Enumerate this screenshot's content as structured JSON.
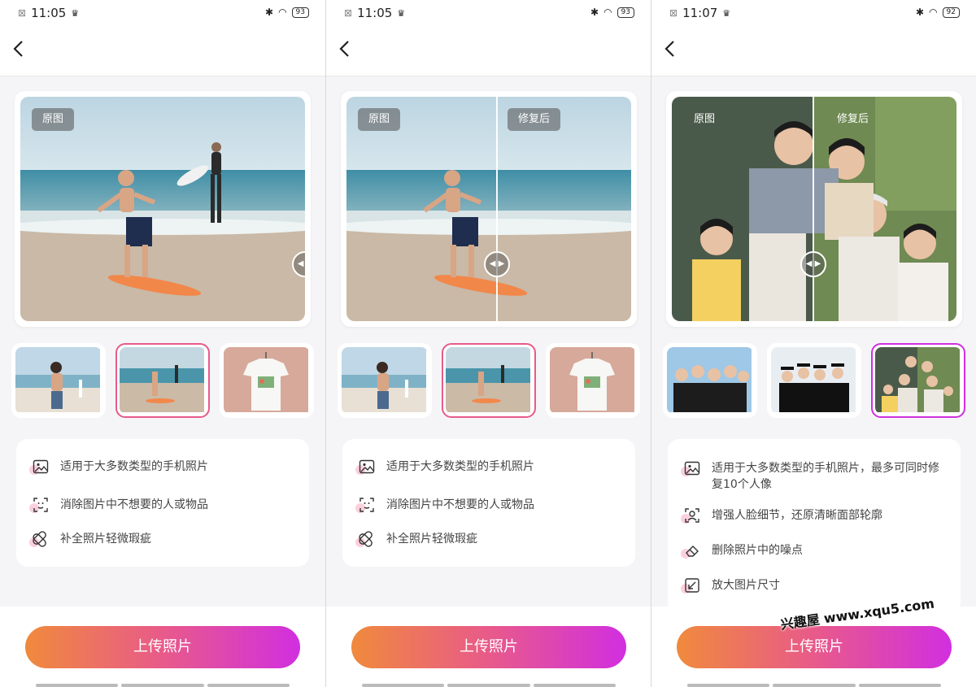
{
  "screens": [
    {
      "status": {
        "time": "11:05",
        "battery": "93"
      },
      "viewer": {
        "label_before": "原图",
        "label_after": ""
      },
      "thumbnails": [
        "beach-woman",
        "surfer-boy",
        "tshirt"
      ],
      "selected_thumbnail": 1,
      "features": [
        {
          "icon": "image-icon",
          "text": "适用于大多数类型的手机照片"
        },
        {
          "icon": "face-scan-icon",
          "text": "消除图片中不想要的人或物品"
        },
        {
          "icon": "bandage-icon",
          "text": "补全照片轻微瑕疵"
        }
      ],
      "upload_label": "上传照片"
    },
    {
      "status": {
        "time": "11:05",
        "battery": "93"
      },
      "viewer": {
        "label_before": "原图",
        "label_after": "修复后"
      },
      "thumbnails": [
        "beach-woman",
        "surfer-boy",
        "tshirt"
      ],
      "selected_thumbnail": 1,
      "features": [
        {
          "icon": "image-icon",
          "text": "适用于大多数类型的手机照片"
        },
        {
          "icon": "face-scan-icon",
          "text": "消除图片中不想要的人或物品"
        },
        {
          "icon": "bandage-icon",
          "text": "补全照片轻微瑕疵"
        }
      ],
      "upload_label": "上传照片"
    },
    {
      "status": {
        "time": "11:07",
        "battery": "92"
      },
      "viewer": {
        "label_before": "原图",
        "label_after": "修复后"
      },
      "thumbnails": [
        "group-friends",
        "graduates",
        "family"
      ],
      "selected_thumbnail": 2,
      "features": [
        {
          "icon": "image-icon",
          "text": "适用于大多数类型的手机照片，最多可同时修复10个人像"
        },
        {
          "icon": "face-scan-icon",
          "text": "增强人脸细节，还原清晰面部轮廓"
        },
        {
          "icon": "eraser-icon",
          "text": "删除照片中的噪点"
        },
        {
          "icon": "enlarge-icon",
          "text": "放大图片尺寸"
        }
      ],
      "upload_label": "上传照片"
    }
  ],
  "watermark": "兴趣屋 www.xqu5.com",
  "colors": {
    "accent_start": "#f08a3c",
    "accent_mid": "#e85a8a",
    "accent_end": "#d12fe0"
  }
}
